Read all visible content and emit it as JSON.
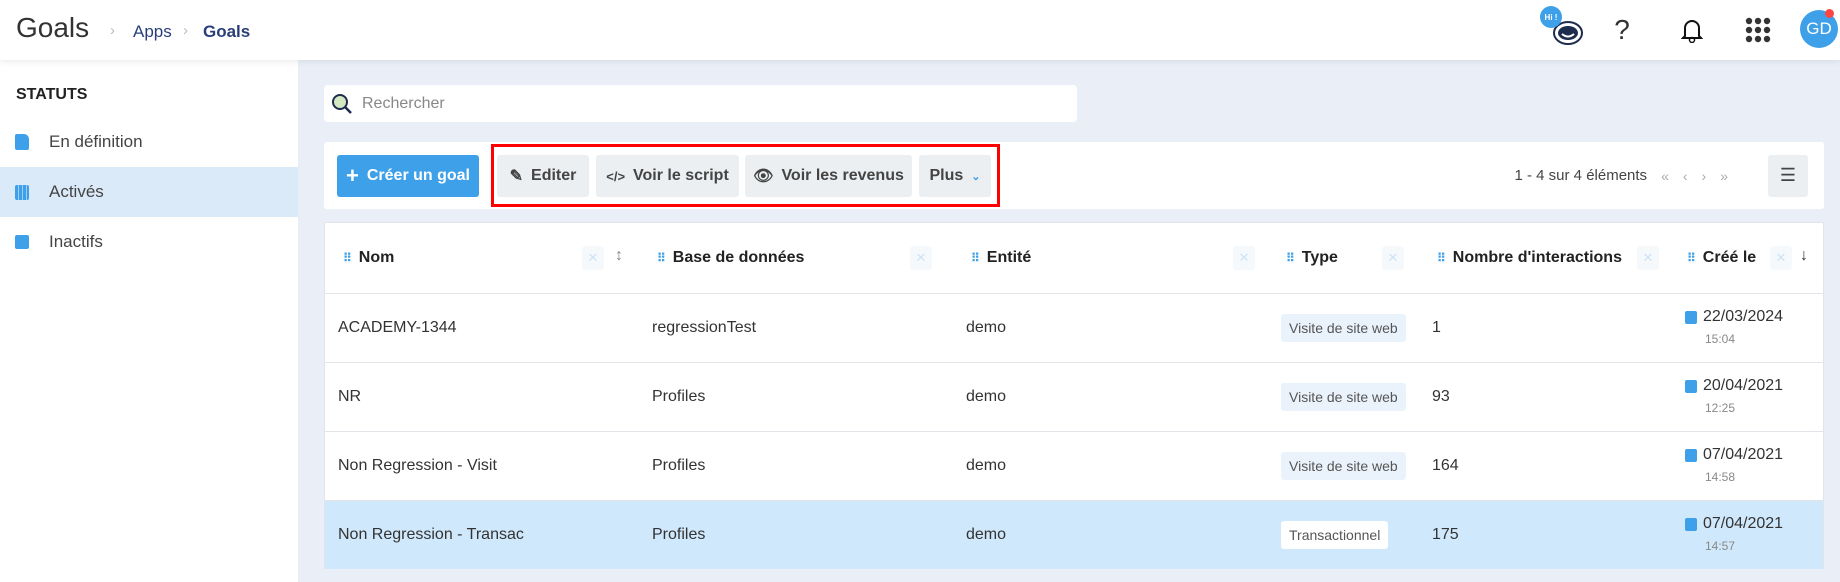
{
  "header": {
    "title": "Goals",
    "breadcrumb": [
      "Apps",
      "Goals"
    ],
    "hi_badge": "Hi !",
    "avatar": "GD"
  },
  "sidebar": {
    "title": "STATUTS",
    "items": [
      {
        "label": "En définition",
        "icon": "file-icon"
      },
      {
        "label": "Activés",
        "icon": "calendar-icon",
        "active": true
      },
      {
        "label": "Inactifs",
        "icon": "square-icon"
      }
    ]
  },
  "search": {
    "placeholder": "Rechercher",
    "value": ""
  },
  "toolbar": {
    "create": "Créer un goal",
    "edit": "Editer",
    "script": "Voir le script",
    "revenue": "Voir les revenus",
    "more": "Plus",
    "pagination": "1 - 4 sur 4 éléments"
  },
  "colors": {
    "accent": "#3fa0ea",
    "highlight": "#ff0000",
    "selected_row": "#cfe8fb"
  },
  "table": {
    "columns": [
      "Nom",
      "Base de données",
      "Entité",
      "Type",
      "Nombre d'interactions",
      "Créé le"
    ],
    "rows": [
      {
        "nom": "ACADEMY-1344",
        "base": "regressionTest",
        "entite": "demo",
        "type": "Visite de site web",
        "interactions": "1",
        "date": "22/03/2024",
        "time": "15:04"
      },
      {
        "nom": "NR",
        "base": "Profiles",
        "entite": "demo",
        "type": "Visite de site web",
        "interactions": "93",
        "date": "20/04/2021",
        "time": "12:25"
      },
      {
        "nom": "Non Regression - Visit",
        "base": "Profiles",
        "entite": "demo",
        "type": "Visite de site web",
        "interactions": "164",
        "date": "07/04/2021",
        "time": "14:58"
      },
      {
        "nom": "Non Regression - Transac",
        "base": "Profiles",
        "entite": "demo",
        "type": "Transactionnel",
        "interactions": "175",
        "date": "07/04/2021",
        "time": "14:57",
        "selected": true
      }
    ]
  }
}
